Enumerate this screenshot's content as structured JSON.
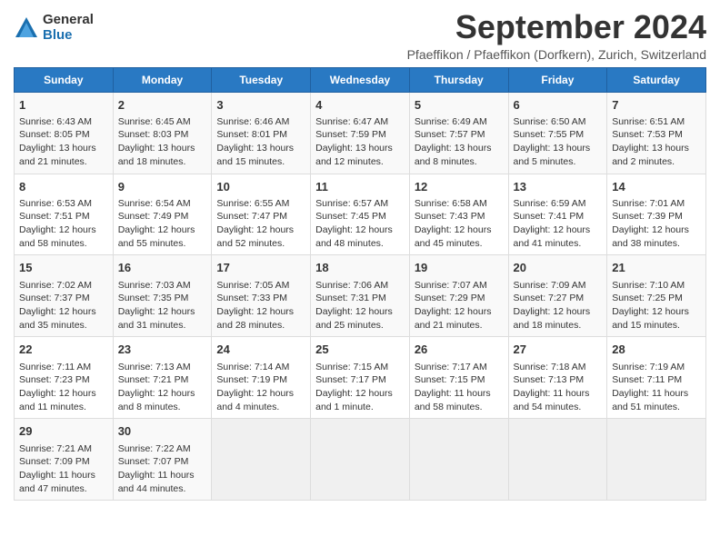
{
  "logo": {
    "general": "General",
    "blue": "Blue"
  },
  "title": "September 2024",
  "location": "Pfaeffikon / Pfaeffikon (Dorfkern), Zurich, Switzerland",
  "days_of_week": [
    "Sunday",
    "Monday",
    "Tuesday",
    "Wednesday",
    "Thursday",
    "Friday",
    "Saturday"
  ],
  "weeks": [
    [
      {
        "day": "1",
        "sunrise": "Sunrise: 6:43 AM",
        "sunset": "Sunset: 8:05 PM",
        "daylight": "Daylight: 13 hours and 21 minutes."
      },
      {
        "day": "2",
        "sunrise": "Sunrise: 6:45 AM",
        "sunset": "Sunset: 8:03 PM",
        "daylight": "Daylight: 13 hours and 18 minutes."
      },
      {
        "day": "3",
        "sunrise": "Sunrise: 6:46 AM",
        "sunset": "Sunset: 8:01 PM",
        "daylight": "Daylight: 13 hours and 15 minutes."
      },
      {
        "day": "4",
        "sunrise": "Sunrise: 6:47 AM",
        "sunset": "Sunset: 7:59 PM",
        "daylight": "Daylight: 13 hours and 12 minutes."
      },
      {
        "day": "5",
        "sunrise": "Sunrise: 6:49 AM",
        "sunset": "Sunset: 7:57 PM",
        "daylight": "Daylight: 13 hours and 8 minutes."
      },
      {
        "day": "6",
        "sunrise": "Sunrise: 6:50 AM",
        "sunset": "Sunset: 7:55 PM",
        "daylight": "Daylight: 13 hours and 5 minutes."
      },
      {
        "day": "7",
        "sunrise": "Sunrise: 6:51 AM",
        "sunset": "Sunset: 7:53 PM",
        "daylight": "Daylight: 13 hours and 2 minutes."
      }
    ],
    [
      {
        "day": "8",
        "sunrise": "Sunrise: 6:53 AM",
        "sunset": "Sunset: 7:51 PM",
        "daylight": "Daylight: 12 hours and 58 minutes."
      },
      {
        "day": "9",
        "sunrise": "Sunrise: 6:54 AM",
        "sunset": "Sunset: 7:49 PM",
        "daylight": "Daylight: 12 hours and 55 minutes."
      },
      {
        "day": "10",
        "sunrise": "Sunrise: 6:55 AM",
        "sunset": "Sunset: 7:47 PM",
        "daylight": "Daylight: 12 hours and 52 minutes."
      },
      {
        "day": "11",
        "sunrise": "Sunrise: 6:57 AM",
        "sunset": "Sunset: 7:45 PM",
        "daylight": "Daylight: 12 hours and 48 minutes."
      },
      {
        "day": "12",
        "sunrise": "Sunrise: 6:58 AM",
        "sunset": "Sunset: 7:43 PM",
        "daylight": "Daylight: 12 hours and 45 minutes."
      },
      {
        "day": "13",
        "sunrise": "Sunrise: 6:59 AM",
        "sunset": "Sunset: 7:41 PM",
        "daylight": "Daylight: 12 hours and 41 minutes."
      },
      {
        "day": "14",
        "sunrise": "Sunrise: 7:01 AM",
        "sunset": "Sunset: 7:39 PM",
        "daylight": "Daylight: 12 hours and 38 minutes."
      }
    ],
    [
      {
        "day": "15",
        "sunrise": "Sunrise: 7:02 AM",
        "sunset": "Sunset: 7:37 PM",
        "daylight": "Daylight: 12 hours and 35 minutes."
      },
      {
        "day": "16",
        "sunrise": "Sunrise: 7:03 AM",
        "sunset": "Sunset: 7:35 PM",
        "daylight": "Daylight: 12 hours and 31 minutes."
      },
      {
        "day": "17",
        "sunrise": "Sunrise: 7:05 AM",
        "sunset": "Sunset: 7:33 PM",
        "daylight": "Daylight: 12 hours and 28 minutes."
      },
      {
        "day": "18",
        "sunrise": "Sunrise: 7:06 AM",
        "sunset": "Sunset: 7:31 PM",
        "daylight": "Daylight: 12 hours and 25 minutes."
      },
      {
        "day": "19",
        "sunrise": "Sunrise: 7:07 AM",
        "sunset": "Sunset: 7:29 PM",
        "daylight": "Daylight: 12 hours and 21 minutes."
      },
      {
        "day": "20",
        "sunrise": "Sunrise: 7:09 AM",
        "sunset": "Sunset: 7:27 PM",
        "daylight": "Daylight: 12 hours and 18 minutes."
      },
      {
        "day": "21",
        "sunrise": "Sunrise: 7:10 AM",
        "sunset": "Sunset: 7:25 PM",
        "daylight": "Daylight: 12 hours and 15 minutes."
      }
    ],
    [
      {
        "day": "22",
        "sunrise": "Sunrise: 7:11 AM",
        "sunset": "Sunset: 7:23 PM",
        "daylight": "Daylight: 12 hours and 11 minutes."
      },
      {
        "day": "23",
        "sunrise": "Sunrise: 7:13 AM",
        "sunset": "Sunset: 7:21 PM",
        "daylight": "Daylight: 12 hours and 8 minutes."
      },
      {
        "day": "24",
        "sunrise": "Sunrise: 7:14 AM",
        "sunset": "Sunset: 7:19 PM",
        "daylight": "Daylight: 12 hours and 4 minutes."
      },
      {
        "day": "25",
        "sunrise": "Sunrise: 7:15 AM",
        "sunset": "Sunset: 7:17 PM",
        "daylight": "Daylight: 12 hours and 1 minute."
      },
      {
        "day": "26",
        "sunrise": "Sunrise: 7:17 AM",
        "sunset": "Sunset: 7:15 PM",
        "daylight": "Daylight: 11 hours and 58 minutes."
      },
      {
        "day": "27",
        "sunrise": "Sunrise: 7:18 AM",
        "sunset": "Sunset: 7:13 PM",
        "daylight": "Daylight: 11 hours and 54 minutes."
      },
      {
        "day": "28",
        "sunrise": "Sunrise: 7:19 AM",
        "sunset": "Sunset: 7:11 PM",
        "daylight": "Daylight: 11 hours and 51 minutes."
      }
    ],
    [
      {
        "day": "29",
        "sunrise": "Sunrise: 7:21 AM",
        "sunset": "Sunset: 7:09 PM",
        "daylight": "Daylight: 11 hours and 47 minutes."
      },
      {
        "day": "30",
        "sunrise": "Sunrise: 7:22 AM",
        "sunset": "Sunset: 7:07 PM",
        "daylight": "Daylight: 11 hours and 44 minutes."
      },
      null,
      null,
      null,
      null,
      null
    ]
  ]
}
